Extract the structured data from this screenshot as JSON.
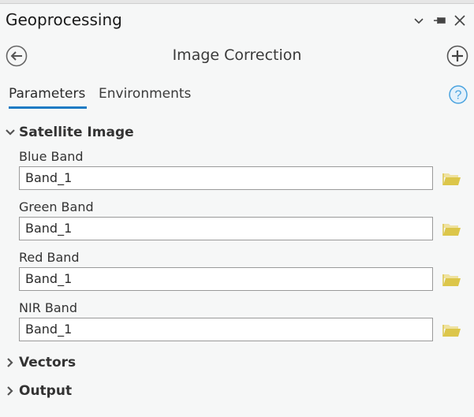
{
  "pane": {
    "title": "Geoprocessing",
    "controls": {
      "options_icon": "chevron-down-icon",
      "pin_icon": "pin-icon",
      "close_icon": "close-icon"
    }
  },
  "tool": {
    "title": "Image Correction",
    "back_icon": "back-arrow-icon",
    "add_icon": "plus-circle-icon"
  },
  "tabs": [
    {
      "label": "Parameters",
      "active": true
    },
    {
      "label": "Environments",
      "active": false
    }
  ],
  "help_icon": "help-icon",
  "groups": [
    {
      "label": "Satellite Image",
      "expanded": true,
      "params": [
        {
          "label": "Blue Band",
          "value": "Band_1"
        },
        {
          "label": "Green Band",
          "value": "Band_1"
        },
        {
          "label": "Red Band",
          "value": "Band_1"
        },
        {
          "label": "NIR Band",
          "value": "Band_1"
        }
      ]
    },
    {
      "label": "Vectors",
      "expanded": false
    },
    {
      "label": "Output",
      "expanded": false
    }
  ],
  "colors": {
    "accent": "#1e7bc4",
    "folder": "#dcc64a",
    "help": "#4aa3df"
  }
}
